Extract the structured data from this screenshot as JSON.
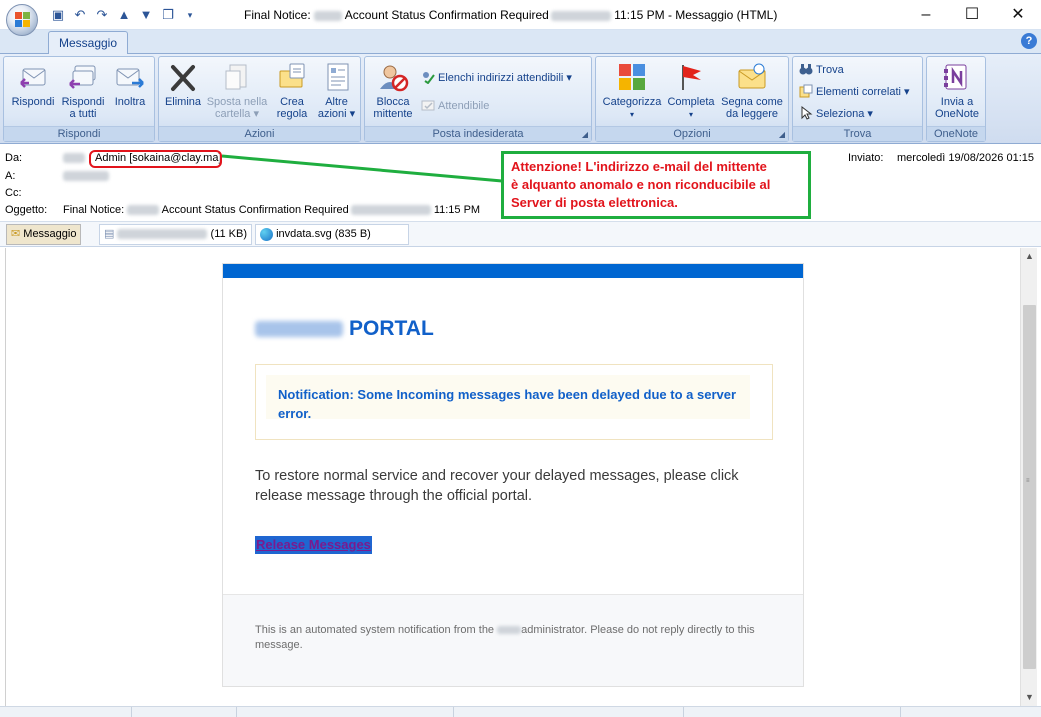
{
  "window": {
    "title_prefix": "Final Notice:",
    "title_subject": "Account Status Confirmation Required",
    "title_suffix": "11:15 PM - Messaggio (HTML)",
    "controls": {
      "minimize": "–",
      "maximize": "☐",
      "close": "✕"
    }
  },
  "quick_access": [
    "save-icon",
    "undo-icon",
    "redo-icon",
    "up-icon",
    "down-icon",
    "copy-icon",
    "dropdown-icon"
  ],
  "tabs": {
    "active": "Messaggio",
    "help": "?"
  },
  "ribbon": {
    "rispondi": {
      "label": "Rispondi",
      "reply": "Rispondi",
      "reply_all_1": "Rispondi",
      "reply_all_2": "a tutti",
      "forward": "Inoltra"
    },
    "azioni": {
      "label": "Azioni",
      "delete": "Elimina",
      "move_1": "Sposta nella",
      "move_2": "cartella ▾",
      "rule_1": "Crea",
      "rule_2": "regola",
      "other_1": "Altre",
      "other_2": "azioni ▾"
    },
    "posta": {
      "label": "Posta indesiderata",
      "block_1": "Blocca",
      "block_2": "mittente",
      "safe_list": "Elenchi indirizzi attendibili ▾",
      "safe": "Attendibile"
    },
    "opzioni": {
      "label": "Opzioni",
      "categorize": "Categorizza",
      "complete": "Completa",
      "unread_1": "Segna come",
      "unread_2": "da leggere"
    },
    "trova": {
      "label": "Trova",
      "find": "Trova",
      "related": "Elementi correlati ▾",
      "select": "Seleziona ▾"
    },
    "onenote": {
      "label": "OneNote",
      "send_1": "Invia a",
      "send_2": "OneNote"
    }
  },
  "headers": {
    "from_label": "Da:",
    "from_value": "Admin [sokaina@clay.ma]",
    "to_label": "A:",
    "cc_label": "Cc:",
    "subject_label": "Oggetto:",
    "subject_prefix": "Final Notice:",
    "subject_text": "Account Status Confirmation Required",
    "subject_time": "11:15 PM",
    "sent_label": "Inviato:",
    "sent_value": "mercoledì 19/08/2026 01:15"
  },
  "warning": {
    "line1": "Attenzione! L'indirizzo e-mail del mittente",
    "line2": "è alquanto anomalo e non riconducibile al",
    "line3": "Server di posta elettronica."
  },
  "attachments": {
    "message": "Messaggio",
    "att1_size": "(11 KB)",
    "att2": "invdata.svg (835 B)"
  },
  "email": {
    "portal_title": "PORTAL",
    "notification": "Notification: Some Incoming messages have been delayed due to a server error.",
    "restore_text": "To restore normal service and recover your delayed messages, please click release message  through the official portal.",
    "release_link": "Release Messages",
    "footer_a": "This is an automated system notification from the",
    "footer_b": "administrator. Please do not reply directly to this message."
  },
  "colors": {
    "accent_blue": "#0066d1",
    "warning_red": "#e2141c",
    "warning_green": "#1fae3f"
  }
}
